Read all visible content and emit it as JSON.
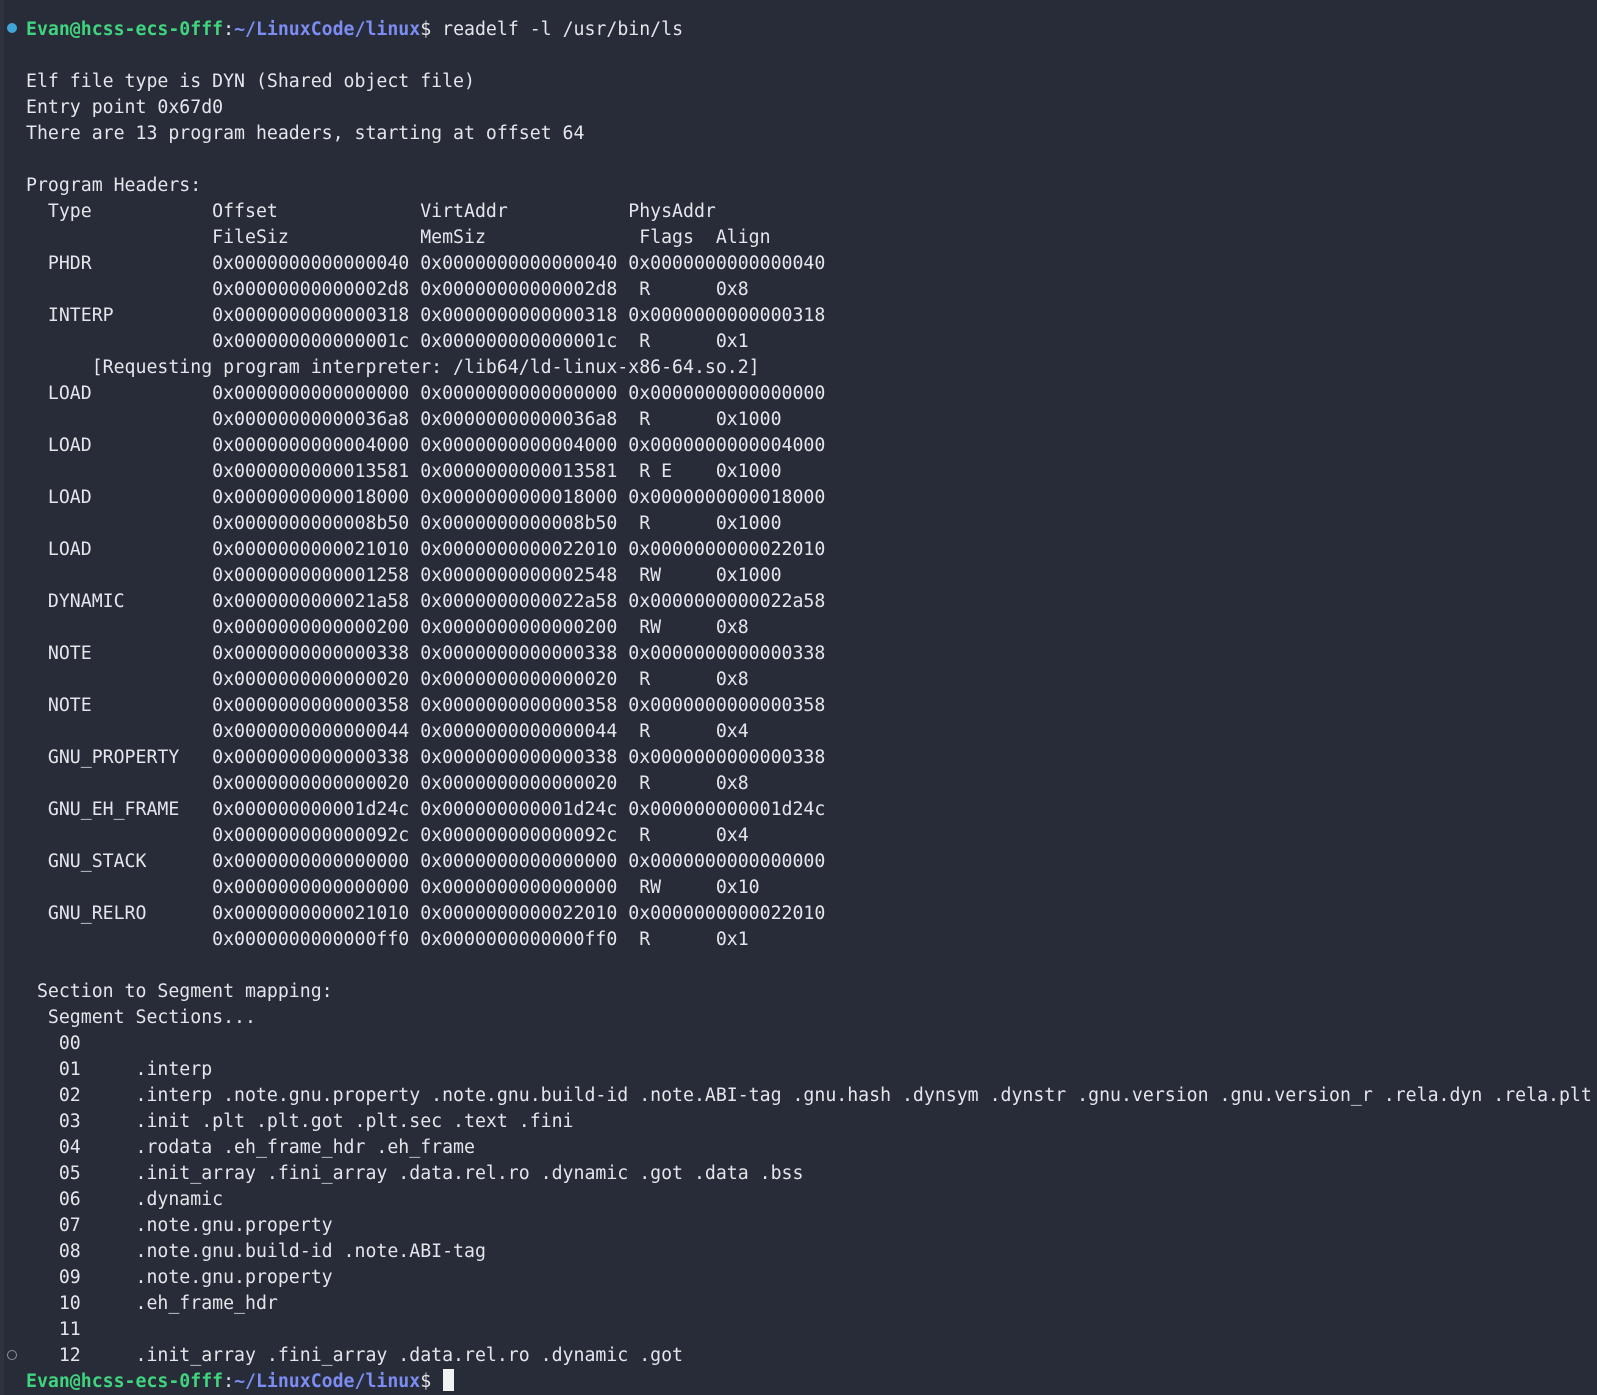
{
  "prompt": {
    "user_host": "Evan@hcss-ecs-0fff",
    "separator": ":",
    "path": "~/LinuxCode/linux",
    "sign": "$ "
  },
  "command": "readelf -l /usr/bin/ls",
  "output_lines": [
    "",
    "Elf file type is DYN (Shared object file)",
    "Entry point 0x67d0",
    "There are 13 program headers, starting at offset 64",
    "",
    "Program Headers:",
    "  Type           Offset             VirtAddr           PhysAddr",
    "                 FileSiz            MemSiz              Flags  Align",
    "  PHDR           0x0000000000000040 0x0000000000000040 0x0000000000000040",
    "                 0x00000000000002d8 0x00000000000002d8  R      0x8",
    "  INTERP         0x0000000000000318 0x0000000000000318 0x0000000000000318",
    "                 0x000000000000001c 0x000000000000001c  R      0x1",
    "      [Requesting program interpreter: /lib64/ld-linux-x86-64.so.2]",
    "  LOAD           0x0000000000000000 0x0000000000000000 0x0000000000000000",
    "                 0x00000000000036a8 0x00000000000036a8  R      0x1000",
    "  LOAD           0x0000000000004000 0x0000000000004000 0x0000000000004000",
    "                 0x0000000000013581 0x0000000000013581  R E    0x1000",
    "  LOAD           0x0000000000018000 0x0000000000018000 0x0000000000018000",
    "                 0x0000000000008b50 0x0000000000008b50  R      0x1000",
    "  LOAD           0x0000000000021010 0x0000000000022010 0x0000000000022010",
    "                 0x0000000000001258 0x0000000000002548  RW     0x1000",
    "  DYNAMIC        0x0000000000021a58 0x0000000000022a58 0x0000000000022a58",
    "                 0x0000000000000200 0x0000000000000200  RW     0x8",
    "  NOTE           0x0000000000000338 0x0000000000000338 0x0000000000000338",
    "                 0x0000000000000020 0x0000000000000020  R      0x8",
    "  NOTE           0x0000000000000358 0x0000000000000358 0x0000000000000358",
    "                 0x0000000000000044 0x0000000000000044  R      0x4",
    "  GNU_PROPERTY   0x0000000000000338 0x0000000000000338 0x0000000000000338",
    "                 0x0000000000000020 0x0000000000000020  R      0x8",
    "  GNU_EH_FRAME   0x000000000001d24c 0x000000000001d24c 0x000000000001d24c",
    "                 0x000000000000092c 0x000000000000092c  R      0x4",
    "  GNU_STACK      0x0000000000000000 0x0000000000000000 0x0000000000000000",
    "                 0x0000000000000000 0x0000000000000000  RW     0x10",
    "  GNU_RELRO      0x0000000000021010 0x0000000000022010 0x0000000000022010",
    "                 0x0000000000000ff0 0x0000000000000ff0  R      0x1",
    "",
    " Section to Segment mapping:",
    "  Segment Sections...",
    "   00     ",
    "   01     .interp ",
    "   02     .interp .note.gnu.property .note.gnu.build-id .note.ABI-tag .gnu.hash .dynsym .dynstr .gnu.version .gnu.version_r .rela.dyn .rela.plt",
    "   03     .init .plt .plt.got .plt.sec .text .fini ",
    "   04     .rodata .eh_frame_hdr .eh_frame ",
    "   05     .init_array .fini_array .data.rel.ro .dynamic .got .data .bss ",
    "   06     .dynamic ",
    "   07     .note.gnu.property ",
    "   08     .note.gnu.build-id .note.ABI-tag ",
    "   09     .note.gnu.property ",
    "   10     .eh_frame_hdr ",
    "   11     ",
    "   12     .init_array .fini_array .data.rel.ro .dynamic .got "
  ],
  "colors": {
    "background": "#282c38",
    "foreground": "#e4e6eb",
    "prompt_user": "#3fd47d",
    "prompt_path": "#7b8cf2",
    "marker_done": "#3fa6d6",
    "marker_idle": "#8a8f9c",
    "cursor": "#f2f2f2"
  }
}
